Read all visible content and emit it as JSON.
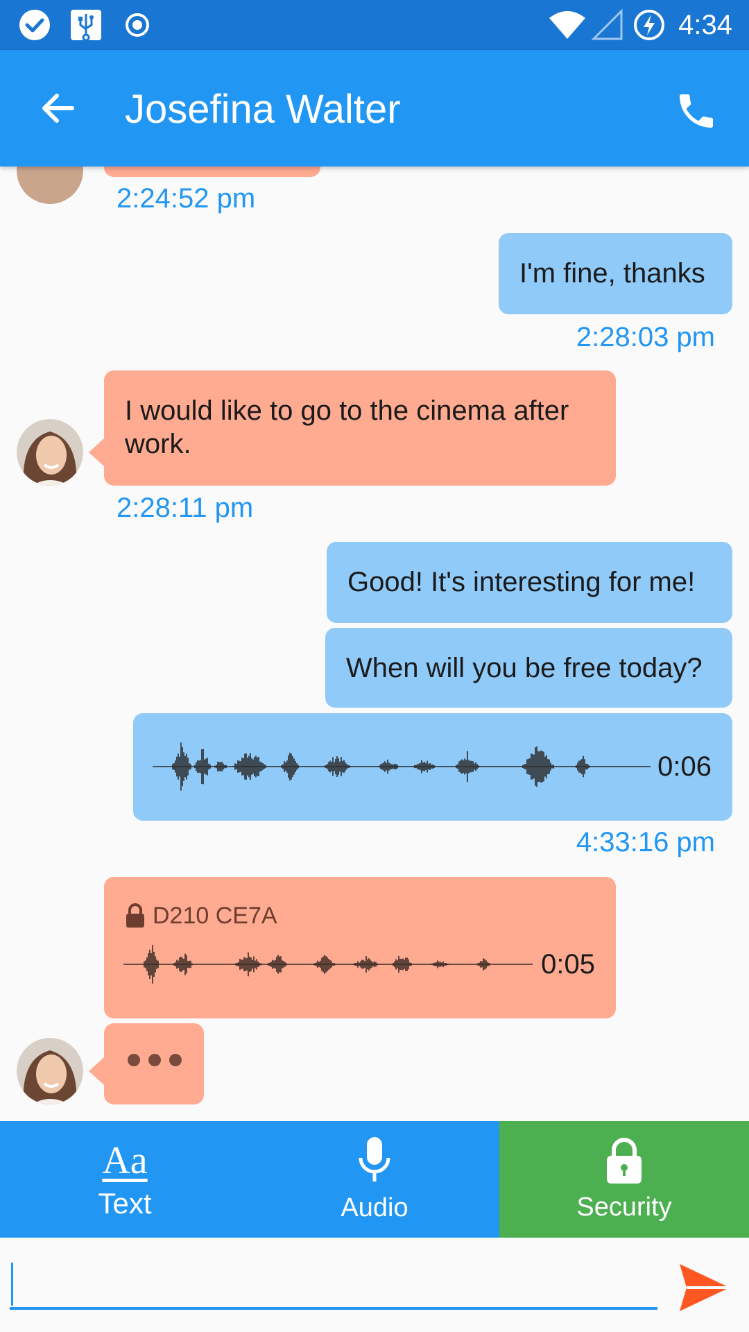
{
  "status_bar": {
    "time": "4:34",
    "icons": [
      "check-circle-icon",
      "usb-icon",
      "radio-target-icon",
      "wifi-icon",
      "signal-icon",
      "battery-charging-icon"
    ]
  },
  "app_bar": {
    "title": "Josefina Walter",
    "icons": [
      "back-arrow-icon",
      "phone-icon"
    ]
  },
  "messages": [
    {
      "dir": "in",
      "time": "2:24:52 pm"
    },
    {
      "dir": "out",
      "text": "I'm fine, thanks",
      "time": "2:28:03 pm"
    },
    {
      "dir": "in",
      "text": "I would like to go to the cinema after work.",
      "time": "2:28:11 pm"
    },
    {
      "dir": "out",
      "text": "Good! It's interesting for me!"
    },
    {
      "dir": "out",
      "text": "When will you be free today?"
    },
    {
      "dir": "out",
      "type": "audio",
      "duration": "0:06",
      "time": "4:33:16 pm"
    },
    {
      "dir": "in",
      "type": "audio",
      "encrypted_key": "D210 CE7A",
      "duration": "0:05"
    },
    {
      "dir": "in",
      "type": "typing"
    }
  ],
  "tabs": [
    {
      "label": "Text",
      "icon_text": "Aa",
      "color": "#2196f3"
    },
    {
      "label": "Audio",
      "icon": "microphone-icon",
      "color": "#2196f3"
    },
    {
      "label": "Security",
      "icon": "lock-icon",
      "color": "#4caf50"
    }
  ],
  "composer": {
    "value": "",
    "placeholder": "",
    "send_icon": "send-icon"
  },
  "colors": {
    "status_bar": "#1976d2",
    "app_bar": "#2196f3",
    "incoming_bubble": "#ffab91",
    "outgoing_bubble": "#90caf9",
    "timestamp": "#2196f3",
    "send_accent": "#ff5722"
  }
}
